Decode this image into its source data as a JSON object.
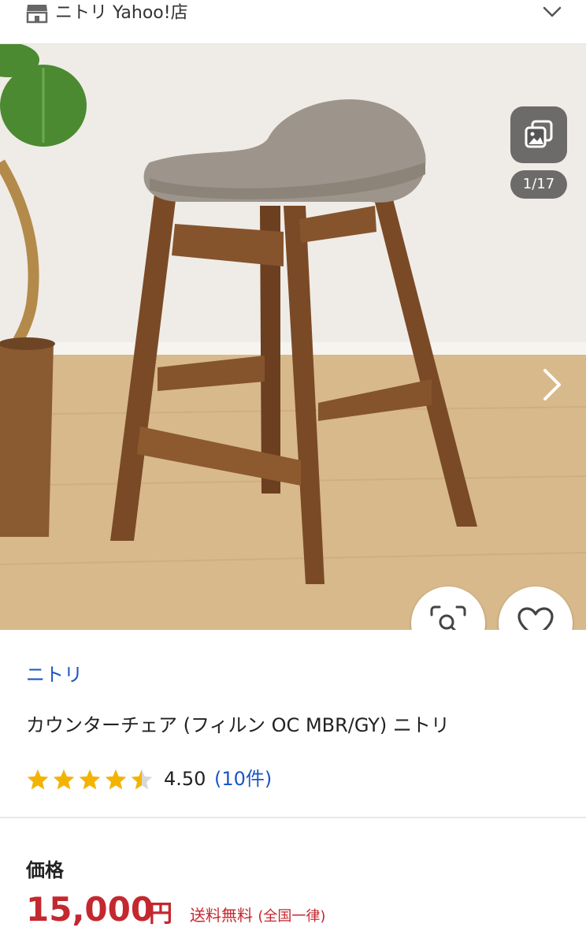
{
  "header": {
    "store_name": "ニトリ Yahoo!店",
    "store_icon": "store-icon",
    "expand_icon": "chevron-down-icon"
  },
  "gallery": {
    "counter": "1/17",
    "gallery_icon": "image-gallery-icon",
    "next_icon": "chevron-right-icon",
    "lens_icon": "image-search-icon",
    "favorite_icon": "heart-icon"
  },
  "product": {
    "brand": "ニトリ",
    "title": "カウンターチェア (フィルン OC MBR/GY) ニトリ",
    "rating": "4.50",
    "rating_fraction": 0.9,
    "review_count": "(10件)"
  },
  "price": {
    "label": "価格",
    "value": "15,000",
    "unit": "円",
    "shipping": "送料無料",
    "shipping_note": "(全国一律)"
  },
  "colors": {
    "link": "#1a56c4",
    "price": "#c4282f",
    "star": "#f5b301"
  }
}
